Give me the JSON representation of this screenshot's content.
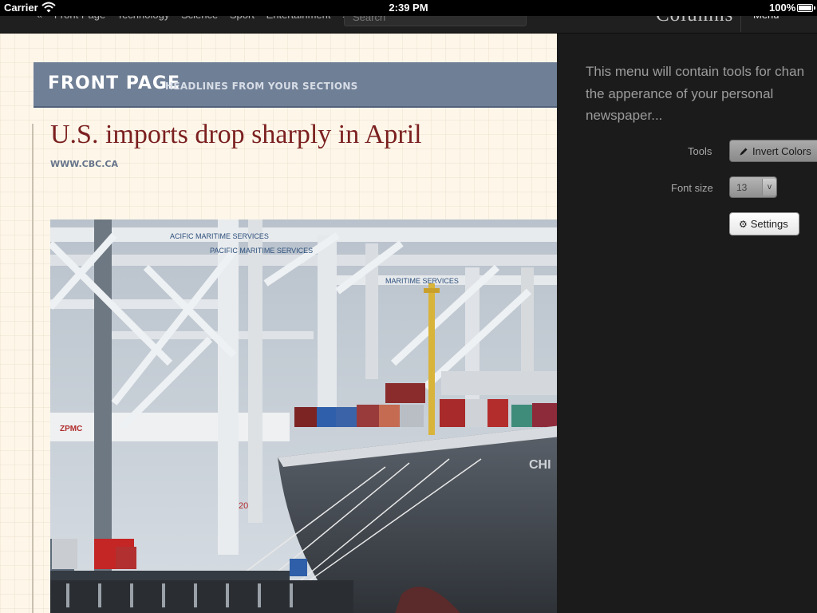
{
  "status_bar": {
    "carrier": "Carrier",
    "time": "2:39 PM",
    "battery": "100%"
  },
  "nav": {
    "sections": [
      "Front Page",
      "Technology",
      "Science",
      "Sport",
      "Entertainment"
    ],
    "left_arrow": "«",
    "right_arrow": "»",
    "search_placeholder": "Search",
    "brand": "Columns",
    "menu_label": "Menu"
  },
  "paper": {
    "section_title": "FRONT PAGE",
    "section_subtitle": "HEADLINES FROM YOUR SECTIONS",
    "article": {
      "headline": "U.S. imports drop sharply in April",
      "source": "WWW.CBC.CA",
      "photo_text": [
        "ACIFIC MARITIME SERVICES",
        "PACIFIC MARITIME SERVICES",
        "MARITIME SERVICES",
        "ZPMC",
        "20",
        "CHI"
      ]
    }
  },
  "menu": {
    "description_lines": [
      "This menu will contain tools for chan",
      "the apperance of your personal",
      "newspaper..."
    ],
    "tools_label": "Tools",
    "invert_button": "Invert Colors",
    "font_size_label": "Font size",
    "font_size_value": "13",
    "settings_button": "Settings"
  },
  "colors": {
    "headline": "#7b1f1f",
    "section_header": "#6f7f96",
    "paper": "#fdf6e9",
    "menu_bg": "#1b1b1b"
  },
  "icons": [
    "wifi-icon",
    "battery-icon",
    "pencil-icon",
    "gear-icon",
    "chevron-down-icon"
  ]
}
